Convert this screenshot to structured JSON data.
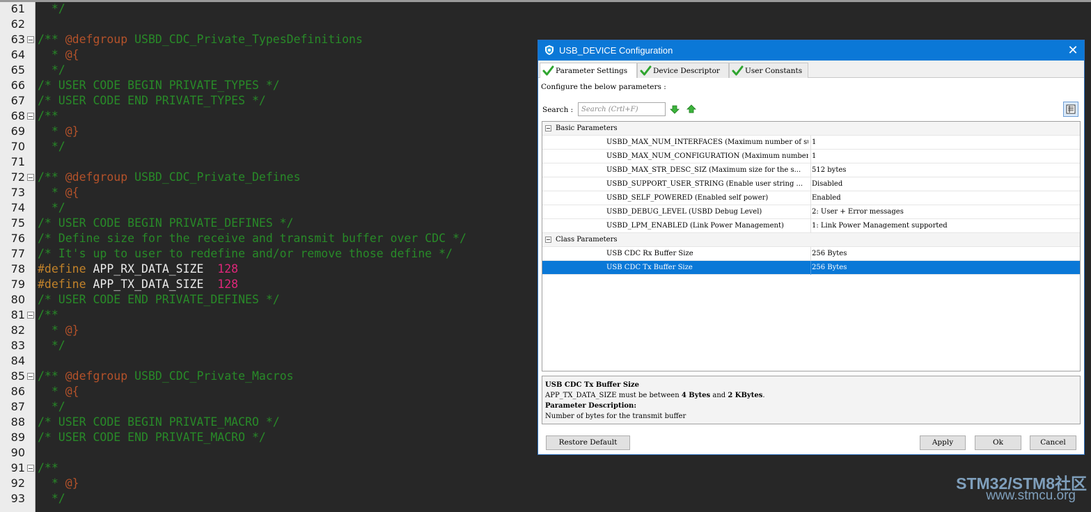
{
  "editor": {
    "lines": [
      {
        "n": "61",
        "fold": false,
        "tokens": [
          {
            "t": "  */",
            "c": "com"
          }
        ]
      },
      {
        "n": "62",
        "fold": false,
        "tokens": []
      },
      {
        "n": "63",
        "fold": true,
        "tokens": [
          {
            "t": "/** ",
            "c": "com"
          },
          {
            "t": "@defgroup",
            "c": "tag"
          },
          {
            "t": " USBD_CDC_Private_TypesDefinitions",
            "c": "com"
          }
        ]
      },
      {
        "n": "64",
        "fold": false,
        "tokens": [
          {
            "t": "  * ",
            "c": "com"
          },
          {
            "t": "@{",
            "c": "tag"
          }
        ]
      },
      {
        "n": "65",
        "fold": false,
        "tokens": [
          {
            "t": "  */",
            "c": "com"
          }
        ]
      },
      {
        "n": "66",
        "fold": false,
        "tokens": [
          {
            "t": "/* USER CODE BEGIN PRIVATE_TYPES */",
            "c": "com"
          }
        ]
      },
      {
        "n": "67",
        "fold": false,
        "tokens": [
          {
            "t": "/* USER CODE END PRIVATE_TYPES */",
            "c": "com"
          }
        ]
      },
      {
        "n": "68",
        "fold": true,
        "tokens": [
          {
            "t": "/**",
            "c": "com"
          }
        ]
      },
      {
        "n": "69",
        "fold": false,
        "tokens": [
          {
            "t": "  * ",
            "c": "com"
          },
          {
            "t": "@}",
            "c": "tag"
          }
        ]
      },
      {
        "n": "70",
        "fold": false,
        "tokens": [
          {
            "t": "  */",
            "c": "com"
          }
        ]
      },
      {
        "n": "71",
        "fold": false,
        "tokens": []
      },
      {
        "n": "72",
        "fold": true,
        "tokens": [
          {
            "t": "/** ",
            "c": "com"
          },
          {
            "t": "@defgroup",
            "c": "tag"
          },
          {
            "t": " USBD_CDC_Private_Defines",
            "c": "com"
          }
        ]
      },
      {
        "n": "73",
        "fold": false,
        "tokens": [
          {
            "t": "  * ",
            "c": "com"
          },
          {
            "t": "@{",
            "c": "tag"
          }
        ]
      },
      {
        "n": "74",
        "fold": false,
        "tokens": [
          {
            "t": "  */",
            "c": "com"
          }
        ]
      },
      {
        "n": "75",
        "fold": false,
        "tokens": [
          {
            "t": "/* USER CODE BEGIN PRIVATE_DEFINES */",
            "c": "com"
          }
        ]
      },
      {
        "n": "76",
        "fold": false,
        "tokens": [
          {
            "t": "/* Define size for the receive and transmit buffer over CDC */",
            "c": "com"
          }
        ]
      },
      {
        "n": "77",
        "fold": false,
        "tokens": [
          {
            "t": "/* It's up to user to redefine and/or remove those define */",
            "c": "com"
          }
        ]
      },
      {
        "n": "78",
        "fold": false,
        "tokens": [
          {
            "t": "#define",
            "c": "pp"
          },
          {
            "t": " APP_RX_DATA_SIZE  ",
            "c": "id"
          },
          {
            "t": "128",
            "c": "num"
          }
        ]
      },
      {
        "n": "79",
        "fold": false,
        "tokens": [
          {
            "t": "#define",
            "c": "pp"
          },
          {
            "t": " APP_TX_DATA_SIZE  ",
            "c": "id"
          },
          {
            "t": "128",
            "c": "num"
          }
        ]
      },
      {
        "n": "80",
        "fold": false,
        "tokens": [
          {
            "t": "/* USER CODE END PRIVATE_DEFINES */",
            "c": "com"
          }
        ]
      },
      {
        "n": "81",
        "fold": true,
        "tokens": [
          {
            "t": "/**",
            "c": "com"
          }
        ]
      },
      {
        "n": "82",
        "fold": false,
        "tokens": [
          {
            "t": "  * ",
            "c": "com"
          },
          {
            "t": "@}",
            "c": "tag"
          }
        ]
      },
      {
        "n": "83",
        "fold": false,
        "tokens": [
          {
            "t": "  */",
            "c": "com"
          }
        ]
      },
      {
        "n": "84",
        "fold": false,
        "tokens": []
      },
      {
        "n": "85",
        "fold": true,
        "tokens": [
          {
            "t": "/** ",
            "c": "com"
          },
          {
            "t": "@defgroup",
            "c": "tag"
          },
          {
            "t": " USBD_CDC_Private_Macros",
            "c": "com"
          }
        ]
      },
      {
        "n": "86",
        "fold": false,
        "tokens": [
          {
            "t": "  * ",
            "c": "com"
          },
          {
            "t": "@{",
            "c": "tag"
          }
        ]
      },
      {
        "n": "87",
        "fold": false,
        "tokens": [
          {
            "t": "  */",
            "c": "com"
          }
        ]
      },
      {
        "n": "88",
        "fold": false,
        "tokens": [
          {
            "t": "/* USER CODE BEGIN PRIVATE_MACRO */",
            "c": "com"
          }
        ]
      },
      {
        "n": "89",
        "fold": false,
        "tokens": [
          {
            "t": "/* USER CODE END PRIVATE_MACRO */",
            "c": "com"
          }
        ]
      },
      {
        "n": "90",
        "fold": false,
        "tokens": []
      },
      {
        "n": "91",
        "fold": true,
        "tokens": [
          {
            "t": "/**",
            "c": "com"
          }
        ]
      },
      {
        "n": "92",
        "fold": false,
        "tokens": [
          {
            "t": "  * ",
            "c": "com"
          },
          {
            "t": "@}",
            "c": "tag"
          }
        ]
      },
      {
        "n": "93",
        "fold": false,
        "tokens": [
          {
            "t": "  */",
            "c": "com"
          }
        ]
      }
    ]
  },
  "dialog": {
    "title": "USB_DEVICE Configuration",
    "close_label": "✕",
    "tabs": [
      {
        "label": "Parameter Settings",
        "active": true
      },
      {
        "label": "Device Descriptor",
        "active": false
      },
      {
        "label": "User Constants",
        "active": false
      }
    ],
    "configure_label": "Configure the below parameters :",
    "search_label": "Search :",
    "search_placeholder": "Search (Crtl+F)",
    "groups": [
      {
        "label": "Basic Parameters",
        "rows": [
          {
            "name": "USBD_MAX_NUM_INTERFACES (Maximum number of su...",
            "value": "1"
          },
          {
            "name": "USBD_MAX_NUM_CONFIGURATION (Maximum number of...",
            "value": "1"
          },
          {
            "name": "USBD_MAX_STR_DESC_SIZ (Maximum size for the s...",
            "value": "512 bytes"
          },
          {
            "name": "USBD_SUPPORT_USER_STRING (Enable user string ...",
            "value": "Disabled"
          },
          {
            "name": "USBD_SELF_POWERED (Enabled self power)",
            "value": "Enabled"
          },
          {
            "name": "USBD_DEBUG_LEVEL (USBD Debug Level)",
            "value": "2: User + Error messages"
          },
          {
            "name": "USBD_LPM_ENABLED (Link Power Management)",
            "value": "1: Link Power Management supported"
          }
        ]
      },
      {
        "label": "Class Parameters",
        "rows": [
          {
            "name": "USB CDC Rx Buffer Size",
            "value": "256 Bytes"
          },
          {
            "name": "USB CDC Tx Buffer Size",
            "value": "256 Bytes",
            "selected": true
          }
        ]
      }
    ],
    "description": {
      "title": "USB CDC Tx Buffer Size",
      "range_prefix": "APP_TX_DATA_SIZE must be between ",
      "range_min": "4 Bytes",
      "range_and": " and ",
      "range_max": "2 KBytes",
      "range_suffix": ".",
      "param_heading": "Parameter Description:",
      "param_text": "Number of bytes for the transmit buffer"
    },
    "buttons": {
      "restore": "Restore Default",
      "apply": "Apply",
      "ok": "Ok",
      "cancel": "Cancel"
    }
  },
  "watermark": {
    "line1": "STM32/STM8社区",
    "line2": "www.stmcu.org"
  },
  "colors": {
    "editor_bg": "#272727",
    "comment": "#288a28",
    "doc_tag": "#b4522a",
    "preprocessor": "#c3832a",
    "number": "#e0267a",
    "titlebar": "#0b78d7",
    "selection": "#0a78d7"
  }
}
